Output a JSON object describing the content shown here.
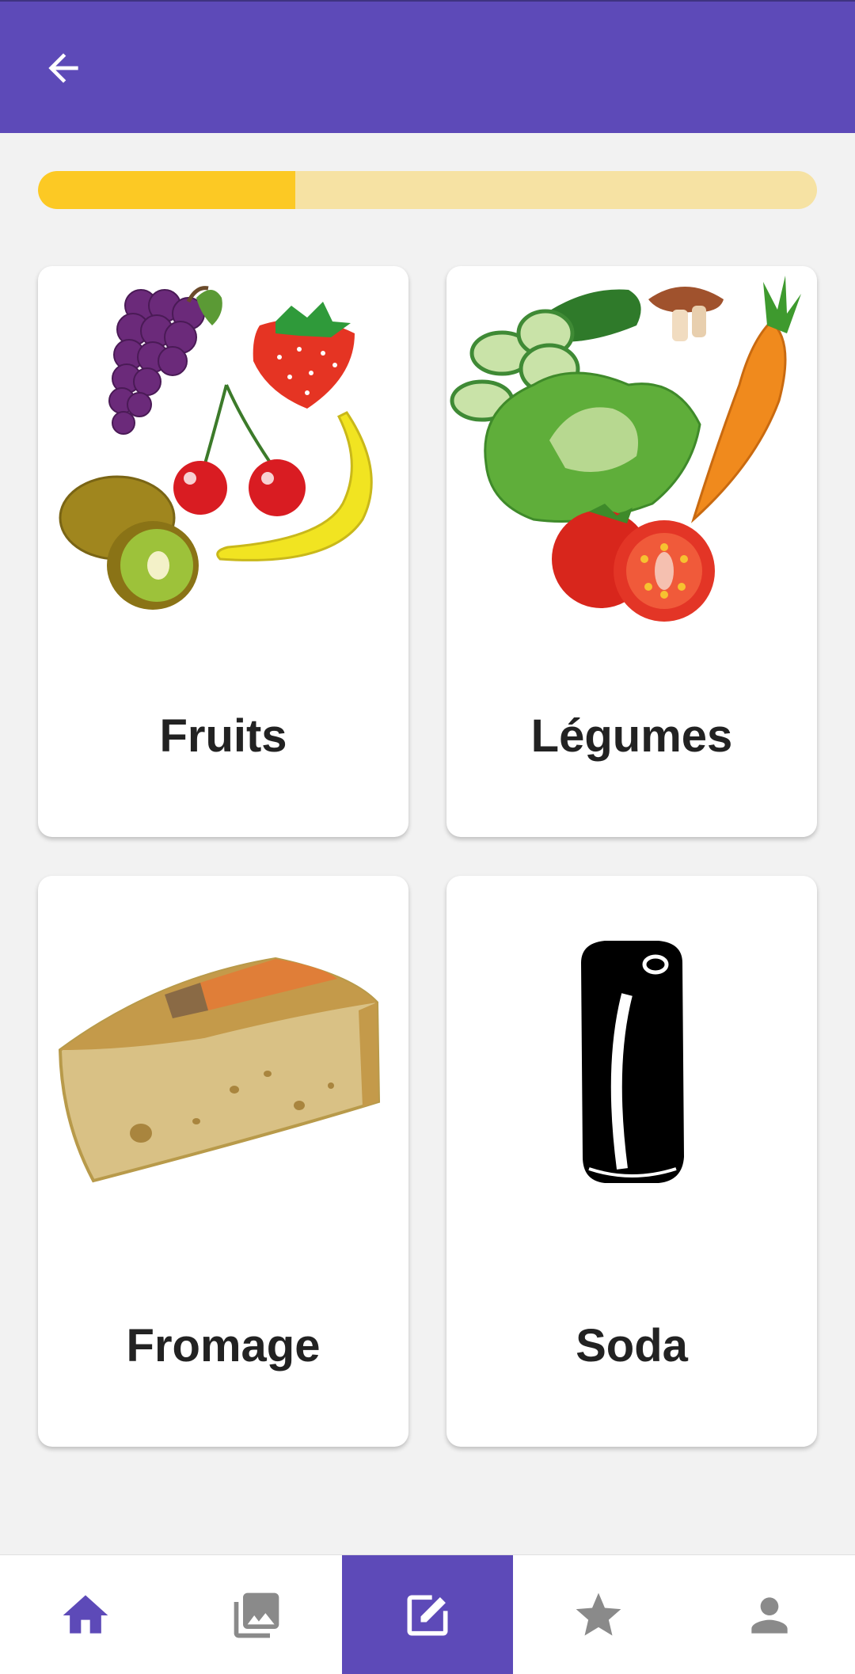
{
  "colors": {
    "primary": "#5d4ab8",
    "progress_fill": "#fcc924",
    "progress_track": "#f6e2a3",
    "icon_active": "#5d4ab8",
    "icon_inactive": "#8a8a8a"
  },
  "header": {
    "back_icon": "arrow-left-icon"
  },
  "progress": {
    "value": 0.33
  },
  "categories": [
    {
      "label": "Fruits",
      "image": "fruits-illustration"
    },
    {
      "label": "Légumes",
      "image": "vegetables-illustration"
    },
    {
      "label": "Fromage",
      "image": "cheese-illustration"
    },
    {
      "label": "Soda",
      "image": "soda-can-illustration"
    }
  ],
  "bottom_nav": {
    "items": [
      {
        "icon": "home-icon",
        "state": "highlighted"
      },
      {
        "icon": "gallery-icon",
        "state": "inactive"
      },
      {
        "icon": "edit-icon",
        "state": "selected"
      },
      {
        "icon": "star-icon",
        "state": "inactive"
      },
      {
        "icon": "person-icon",
        "state": "inactive"
      }
    ]
  }
}
